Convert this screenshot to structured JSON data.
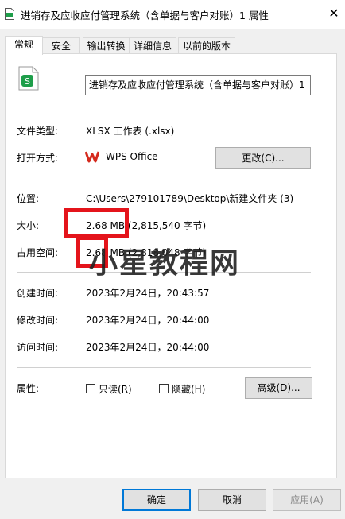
{
  "window": {
    "title": "进销存及应收应付管理系统（含单据与客户对账）1 属性",
    "close": "✕"
  },
  "tabs": [
    "常规",
    "安全",
    "输出转换",
    "详细信息",
    "以前的版本"
  ],
  "file": {
    "name": "进销存及应收应付管理系统（含单据与客户对账）1"
  },
  "props": {
    "type_label": "文件类型:",
    "type_value": "XLSX 工作表 (.xlsx)",
    "open_label": "打开方式:",
    "open_app": "WPS Office",
    "change_button": "更改(C)...",
    "location_label": "位置:",
    "location_value": "C:\\Users\\279101789\\Desktop\\新建文件夹 (3)",
    "size_label": "大小:",
    "size_value": "2.68 MB (2,815,540 字节)",
    "disk_label": "占用空间:",
    "disk_value": "2.68 MB (2,818,048 字节)",
    "created_label": "创建时间:",
    "created_value": "2023年2月24日，20:43:57",
    "modified_label": "修改时间:",
    "modified_value": "2023年2月24日，20:44:00",
    "accessed_label": "访问时间:",
    "accessed_value": "2023年2月24日，20:44:00",
    "attr_label": "属性:",
    "readonly_label": "只读(R)",
    "hidden_label": "隐藏(H)",
    "advanced_button": "高级(D)..."
  },
  "footer": {
    "ok": "确定",
    "cancel": "取消",
    "apply": "应用(A)"
  },
  "watermark": "小星教程网",
  "colors": {
    "accent": "#0078d7",
    "highlight": "#e4141b",
    "excel_green": "#1e9e4a",
    "wps_red": "#d52b1e"
  }
}
